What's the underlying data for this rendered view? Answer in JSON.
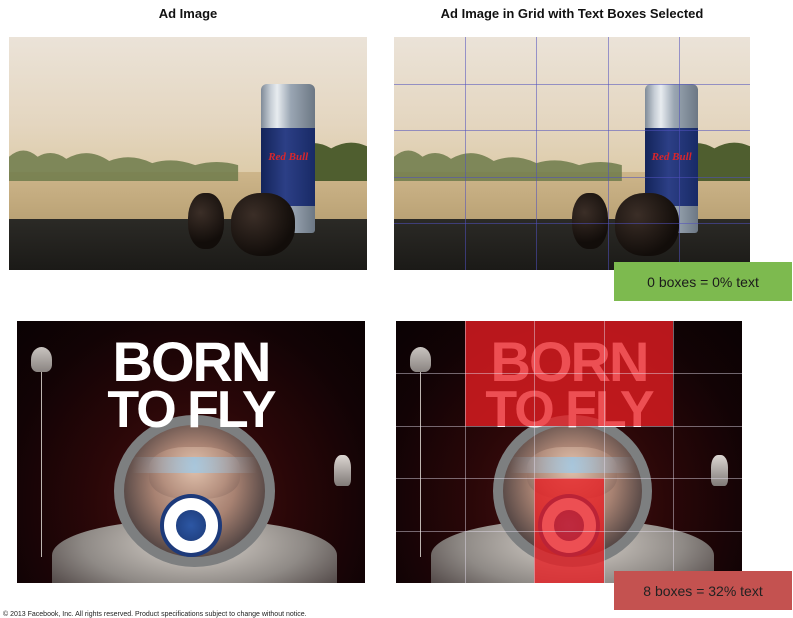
{
  "headings": {
    "left": "Ad Image",
    "right": "Ad Image in Grid with Text Boxes Selected"
  },
  "can_text": "Red Bull",
  "poster": {
    "line1": "BORN",
    "line2": "TO FLY"
  },
  "tags": {
    "green": "0 boxes = 0% text",
    "red": "8 boxes = 32% text"
  },
  "colors": {
    "green_tag": "#7dba4f",
    "red_tag": "#c45250",
    "selection_red": "#e81e22",
    "grid_line": "#5050be"
  },
  "footer": "© 2013 Facebook, Inc. All rights reserved. Product specifications subject to change without notice."
}
